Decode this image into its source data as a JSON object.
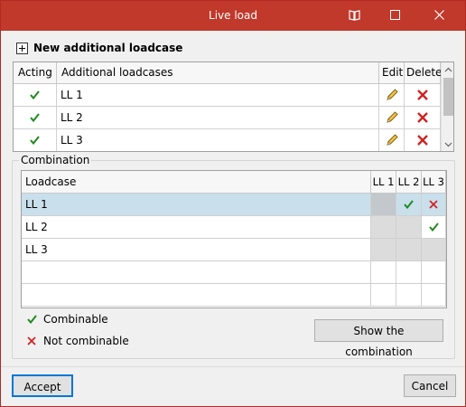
{
  "window": {
    "title": "Live load"
  },
  "toolbar": {
    "new_label": "New additional loadcase"
  },
  "loadcases": {
    "headers": {
      "acting": "Acting",
      "name": "Additional loadcases",
      "edit": "Edit",
      "delete": "Delete"
    },
    "rows": [
      {
        "acting": true,
        "name": "LL 1"
      },
      {
        "acting": true,
        "name": "LL 2"
      },
      {
        "acting": true,
        "name": "LL 3"
      }
    ]
  },
  "combination": {
    "legend": "Combination",
    "headers": {
      "loadcase": "Loadcase",
      "c1": "LL 1",
      "c2": "LL 2",
      "c3": "LL 3"
    },
    "rows": [
      {
        "name": "LL 1",
        "selected": true,
        "cells": [
          "gray",
          "check",
          "cross"
        ]
      },
      {
        "name": "LL 2",
        "selected": false,
        "cells": [
          "gray",
          "gray",
          "check"
        ]
      },
      {
        "name": "LL 3",
        "selected": false,
        "cells": [
          "gray",
          "gray",
          "gray"
        ]
      }
    ],
    "legend_items": {
      "combinable": "Combinable",
      "not_combinable": "Not combinable"
    },
    "show_button": "Show the combination"
  },
  "footer": {
    "accept": "Accept",
    "cancel": "Cancel"
  },
  "colors": {
    "titlebar": "#c0392b",
    "check": "#1e8a1e",
    "cross": "#d32222",
    "selected_row": "#c9dfeb",
    "accent": "#0078d7"
  },
  "icons": [
    "book-icon",
    "maximize-icon",
    "close-icon",
    "plus-icon",
    "check-icon",
    "pencil-icon",
    "delete-x-icon",
    "scroll-up-icon",
    "scroll-down-icon"
  ]
}
